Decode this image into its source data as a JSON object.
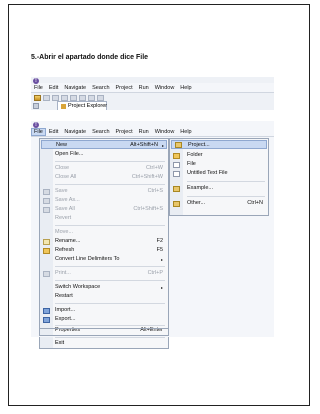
{
  "heading": "5.-Abrir el apartado donde dice File",
  "app_logo_glyph": "!",
  "screenshot1": {
    "menubar": [
      "File",
      "Edit",
      "Navigate",
      "Search",
      "Project",
      "Run",
      "Window",
      "Help"
    ],
    "tab_label": "Project Explorer"
  },
  "screenshot2": {
    "menubar": [
      "File",
      "Edit",
      "Navigate",
      "Search",
      "Project",
      "Run",
      "Window",
      "Help"
    ],
    "file_menu": {
      "new": {
        "label": "New",
        "shortcut": "Alt+Shift+N",
        "arrow": "▸"
      },
      "open_file": {
        "label": "Open File..."
      },
      "close": {
        "label": "Close",
        "shortcut": "Ctrl+W"
      },
      "close_all": {
        "label": "Close All",
        "shortcut": "Ctrl+Shift+W"
      },
      "save": {
        "label": "Save",
        "shortcut": "Ctrl+S"
      },
      "save_as": {
        "label": "Save As..."
      },
      "save_all": {
        "label": "Save All",
        "shortcut": "Ctrl+Shift+S"
      },
      "revert": {
        "label": "Revert"
      },
      "move": {
        "label": "Move..."
      },
      "rename": {
        "label": "Rename...",
        "shortcut": "F2"
      },
      "refresh": {
        "label": "Refresh",
        "shortcut": "F5"
      },
      "convert": {
        "label": "Convert Line Delimiters To",
        "arrow": "▸"
      },
      "print": {
        "label": "Print...",
        "shortcut": "Ctrl+P"
      },
      "switch_workspace": {
        "label": "Switch Workspace",
        "arrow": "▸"
      },
      "restart": {
        "label": "Restart"
      },
      "import": {
        "label": "Import..."
      },
      "export": {
        "label": "Export..."
      },
      "properties": {
        "label": "Properties",
        "shortcut": "Alt+Enter"
      },
      "exit": {
        "label": "Exit"
      }
    },
    "new_submenu": {
      "project": {
        "label": "Project..."
      },
      "folder": {
        "label": "Folder"
      },
      "file": {
        "label": "File"
      },
      "untitled": {
        "label": "Untitled Text File"
      },
      "example": {
        "label": "Example..."
      },
      "other": {
        "label": "Other...",
        "shortcut": "Ctrl+N"
      }
    }
  }
}
